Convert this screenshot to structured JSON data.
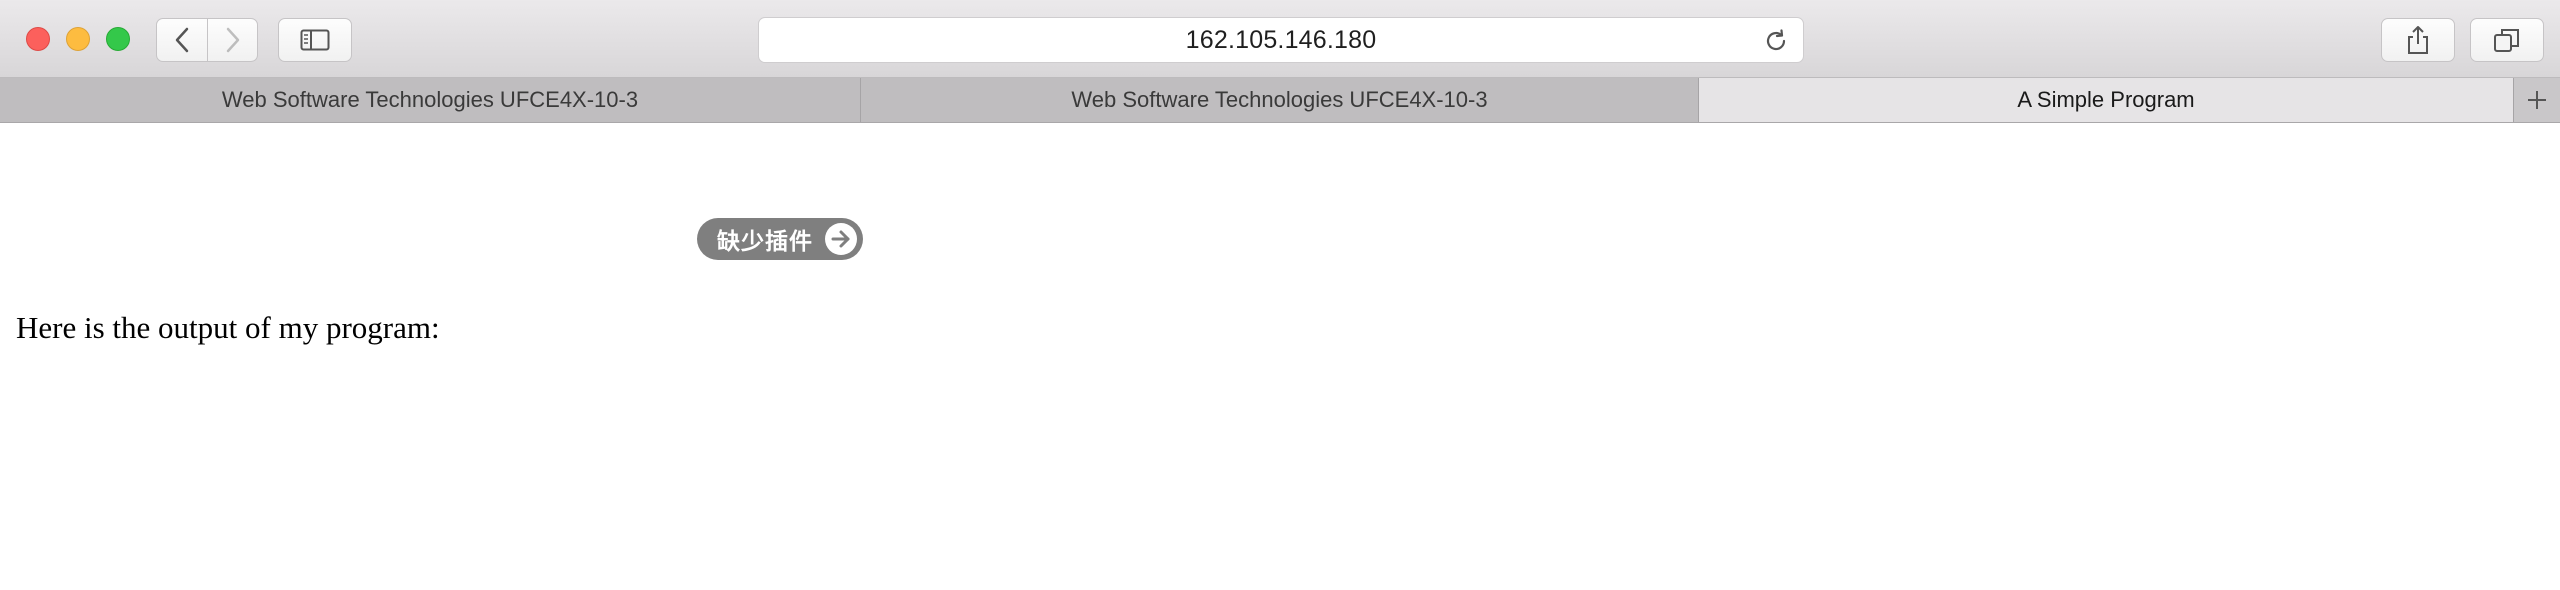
{
  "browser": {
    "address": {
      "url": "162.105.146.180"
    },
    "icons": {
      "back": "chevron-left-icon",
      "forward": "chevron-right-icon",
      "sidebar": "sidebar-icon",
      "reload": "reload-icon",
      "share": "share-icon",
      "tabs_overview": "tabs-overview-icon",
      "new_tab": "plus-icon"
    }
  },
  "tabs": [
    {
      "label": "Web Software Technologies UFCE4X-10-3",
      "active": false
    },
    {
      "label": "Web Software Technologies UFCE4X-10-3",
      "active": false
    },
    {
      "label": "A Simple Program",
      "active": true
    }
  ],
  "page": {
    "plugin_notice": "缺少插件",
    "output_text": "Here is the output of my program:"
  },
  "colors": {
    "close": "#fc605c",
    "minimize": "#fdbc40",
    "maximize": "#34c84a",
    "plugin_pill": "#7f7f7f"
  }
}
